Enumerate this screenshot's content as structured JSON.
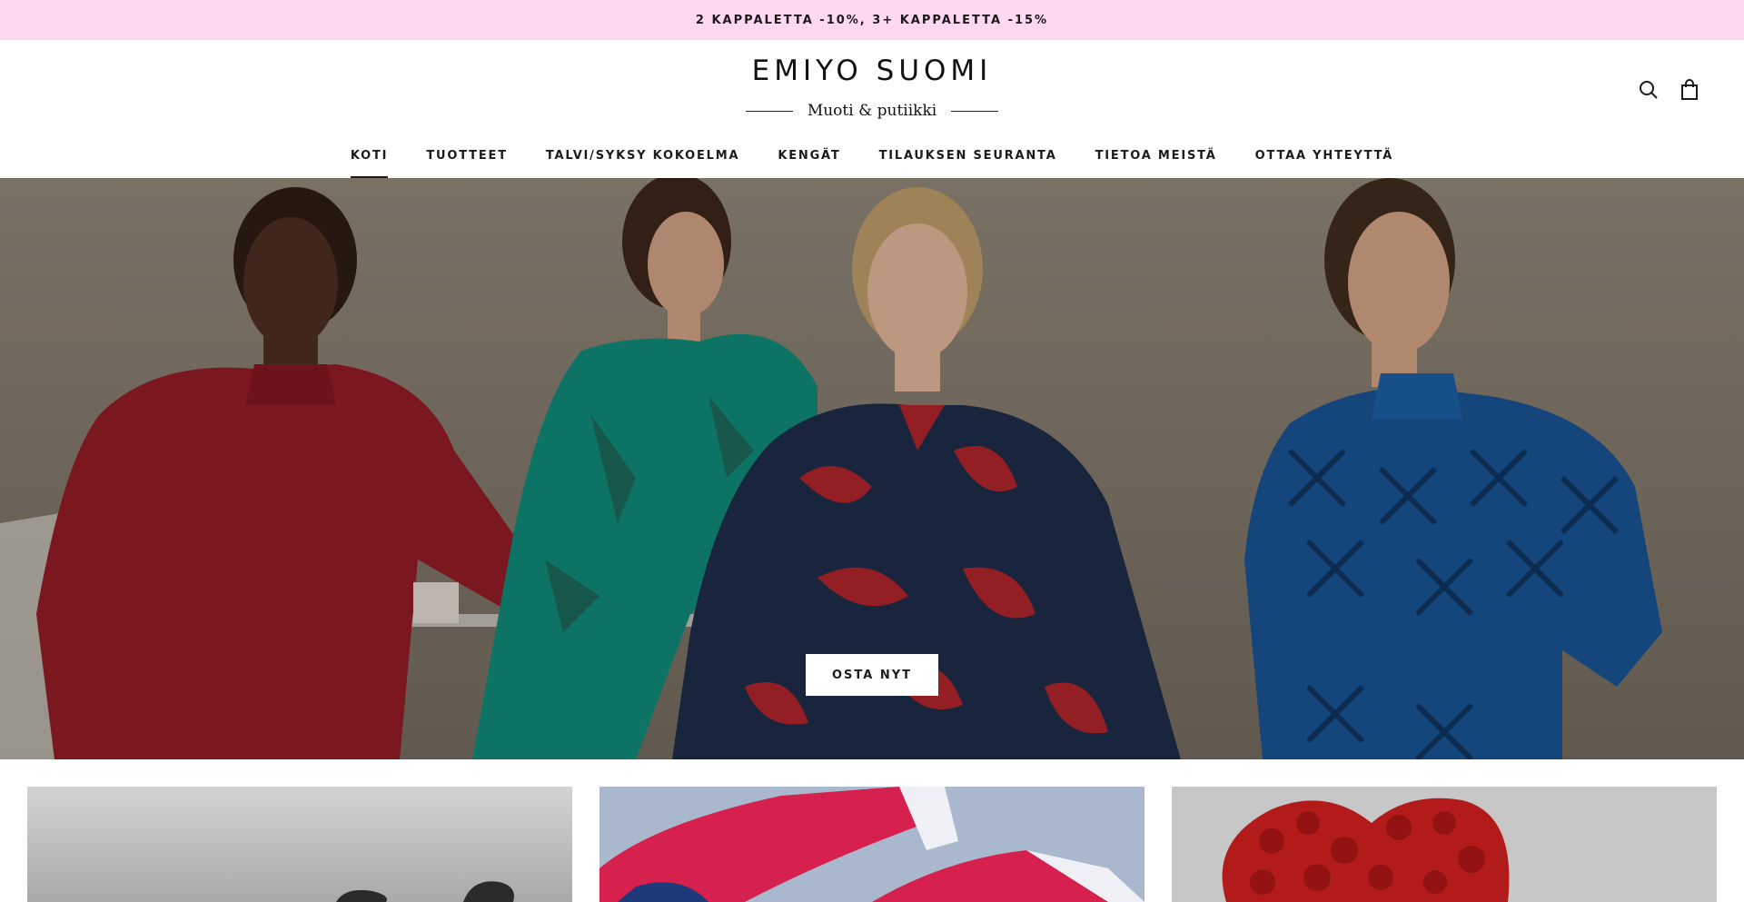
{
  "announcement": {
    "text": "2 KAPPALETTA -10%, 3+ KAPPALETTA -15%",
    "background": "#fdd8f0"
  },
  "brand": {
    "name": "EMIYO SUOMI",
    "tagline": "Muoti & putiikki"
  },
  "header_icons": [
    "search-icon",
    "shopping-bag-icon"
  ],
  "nav": {
    "items": [
      {
        "label": "KOTI",
        "active": true
      },
      {
        "label": "TUOTTEET",
        "active": false
      },
      {
        "label": "TALVI/SYKSY KOKOELMA",
        "active": false
      },
      {
        "label": "KENGÄT",
        "active": false
      },
      {
        "label": "TILAUKSEN SEURANTA",
        "active": false
      },
      {
        "label": "TIETOA MEISTÄ",
        "active": false
      },
      {
        "label": "OTTAA YHTEYTTÄ",
        "active": false
      }
    ]
  },
  "hero": {
    "cta_label": "OSTA NYT"
  },
  "collection_cards": [
    {
      "image": "shoes-grey-background"
    },
    {
      "image": "red-sneakers-blue-background"
    },
    {
      "image": "red-rose-heart-grey-background"
    }
  ],
  "colors": {
    "text": "#1c1b1b",
    "announcement_bg": "#fdd8f0"
  }
}
